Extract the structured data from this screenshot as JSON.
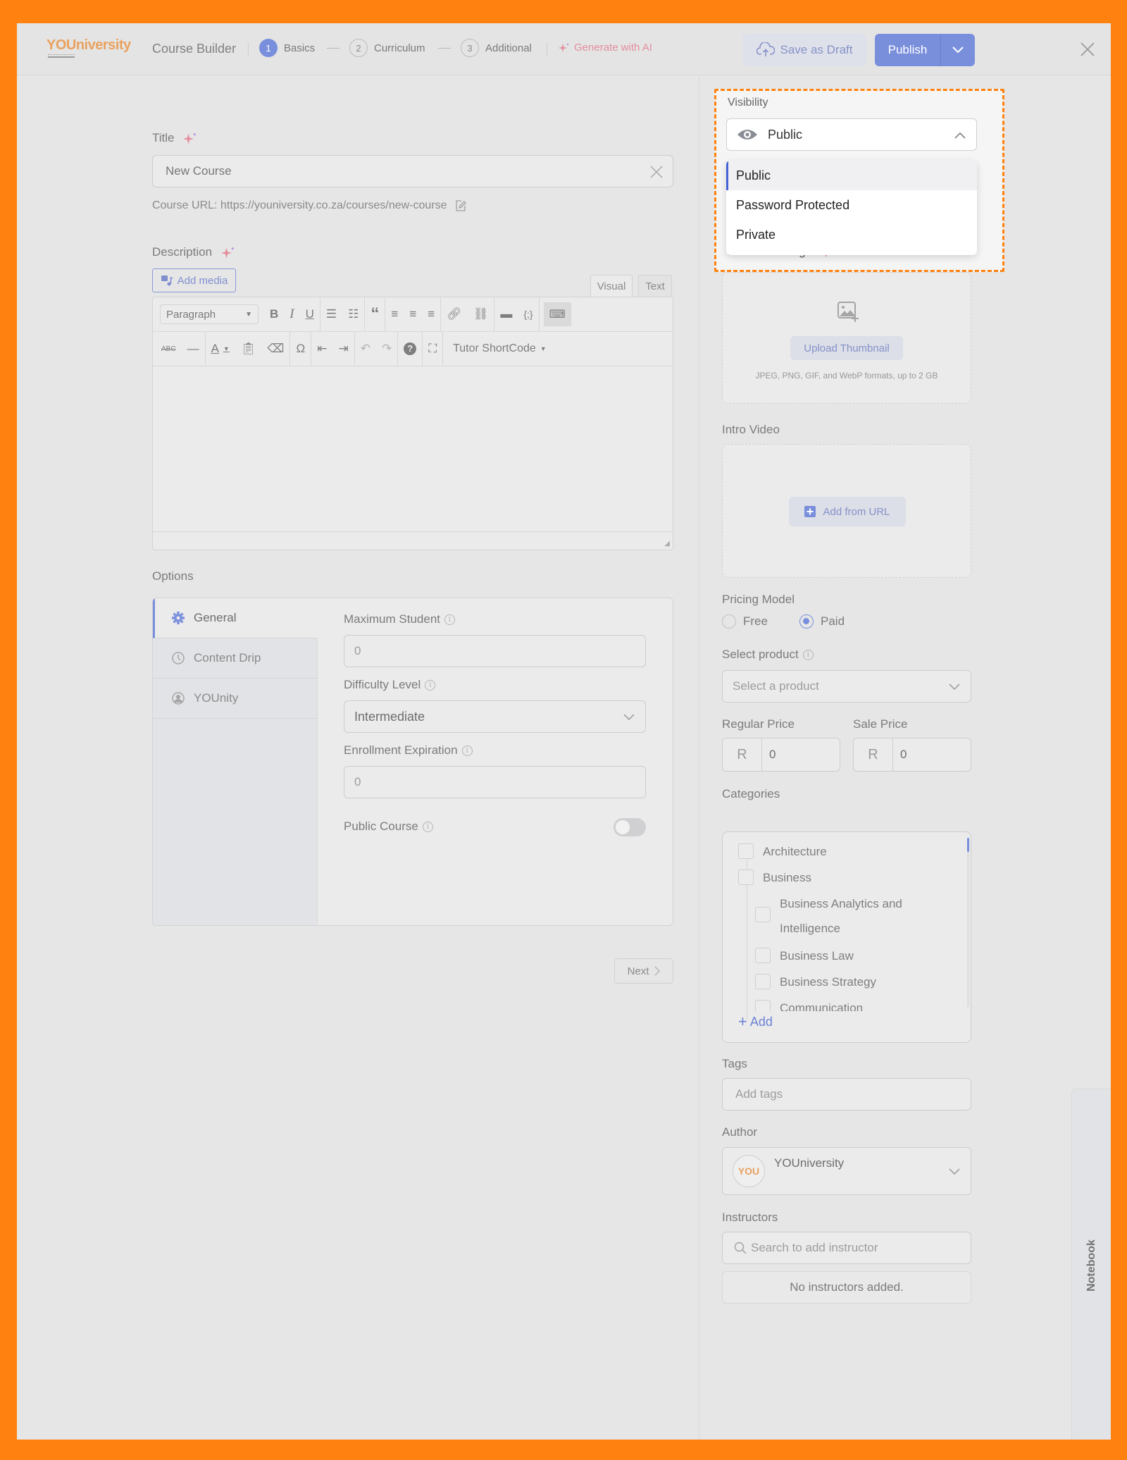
{
  "header": {
    "logo": {
      "bold": "YOU",
      "rest": "niversity"
    },
    "title": "Course Builder",
    "steps": [
      {
        "num": "1",
        "label": "Basics",
        "active": true
      },
      {
        "num": "2",
        "label": "Curriculum",
        "active": false
      },
      {
        "num": "3",
        "label": "Additional",
        "active": false
      }
    ],
    "generate_ai": "Generate with AI",
    "save_draft": "Save as Draft",
    "publish": "Publish"
  },
  "basics": {
    "title_label": "Title",
    "title_value": "New Course",
    "course_url": "Course URL: https://youniversity.co.za/courses/new-course",
    "description_label": "Description",
    "add_media": "Add media",
    "editor_tabs": [
      "Visual",
      "Text"
    ],
    "paragraph_select": "Paragraph",
    "shortcode": "Tutor ShortCode"
  },
  "options": {
    "heading": "Options",
    "tabs": [
      {
        "label": "General",
        "icon": "gear-icon",
        "active": true
      },
      {
        "label": "Content Drip",
        "icon": "clock-icon",
        "active": false
      },
      {
        "label": "YOUnity",
        "icon": "community-icon",
        "active": false
      }
    ],
    "fields": {
      "max_student_label": "Maximum Student",
      "max_student_value": "0",
      "difficulty_label": "Difficulty Level",
      "difficulty_value": "Intermediate",
      "enrollment_label": "Enrollment Expiration",
      "enrollment_value": "0",
      "public_course_label": "Public Course",
      "public_course_on": false
    },
    "next": "Next"
  },
  "sidebar": {
    "visibility": {
      "label": "Visibility",
      "value": "Public",
      "options": [
        "Public",
        "Password Protected",
        "Private"
      ],
      "selected_index": 0
    },
    "featured_image_label": "Featured Image",
    "upload_thumbnail": "Upload Thumbnail",
    "upload_hint": "JPEG, PNG, GIF, and WebP formats, up to 2 GB",
    "intro_video_label": "Intro Video",
    "add_from_url": "Add from URL",
    "pricing": {
      "label": "Pricing Model",
      "options": [
        "Free",
        "Paid"
      ],
      "selected": "Paid"
    },
    "select_product_label": "Select product",
    "select_product_placeholder": "Select a product",
    "regular_price_label": "Regular Price",
    "sale_price_label": "Sale Price",
    "currency": "R",
    "regular_price": "0",
    "sale_price": "0",
    "categories_label": "Categories",
    "categories": [
      {
        "label": "Architecture",
        "level": 0
      },
      {
        "label": "Business",
        "level": 0
      },
      {
        "label": "Business Analytics and Intelligence",
        "level": 1
      },
      {
        "label": "Business Law",
        "level": 1
      },
      {
        "label": "Business Strategy",
        "level": 1
      },
      {
        "label": "Communication",
        "level": 1
      }
    ],
    "add_category": "Add",
    "tags_label": "Tags",
    "tags_placeholder": "Add tags",
    "author_label": "Author",
    "author_name": "YOUniversity",
    "author_avatar": "YOU",
    "instructors_label": "Instructors",
    "instructors_placeholder": "Search to add instructor",
    "no_instructors": "No instructors added."
  },
  "notebook": "Notebook"
}
